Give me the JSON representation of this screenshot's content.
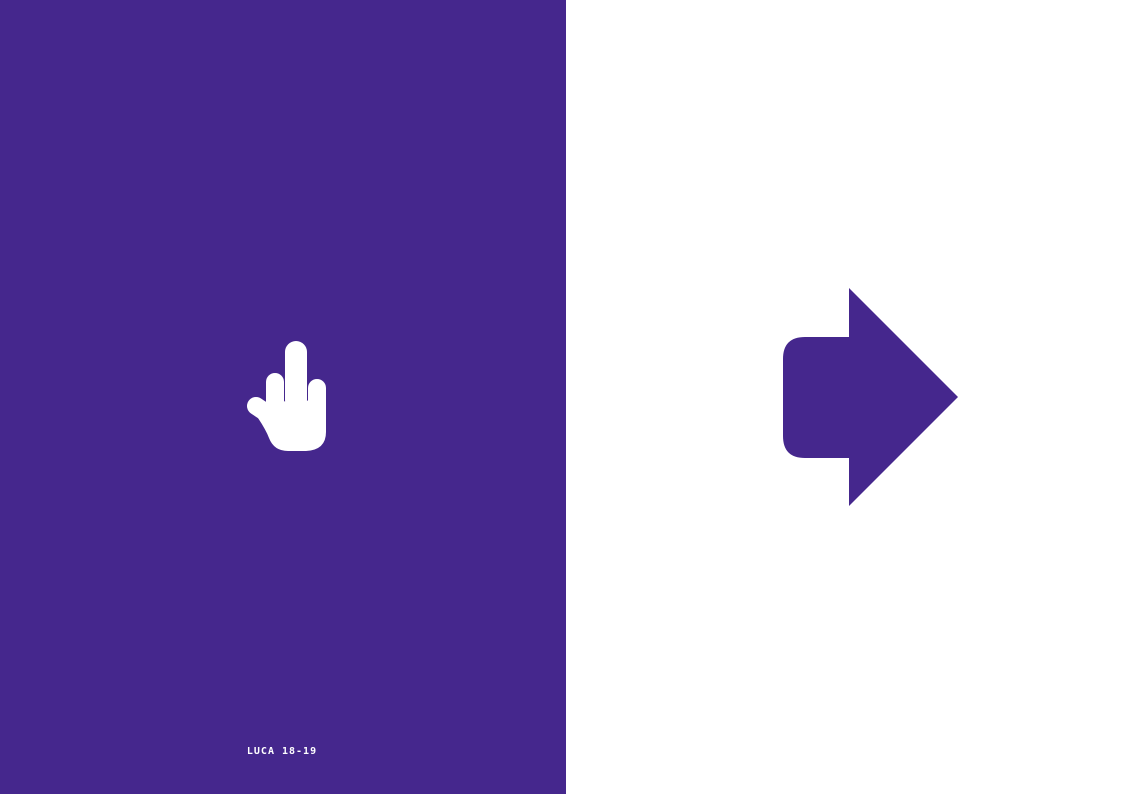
{
  "colors": {
    "left_background": "#45278D",
    "right_background": "#FFFFFF",
    "hand": "#FFFFFF",
    "arrow": "#45278D",
    "caption": "#FFFFFF"
  },
  "left_page": {
    "icon": "middle-finger-hand-icon",
    "caption": "LUCA 18-19"
  },
  "right_page": {
    "icon": "right-arrow-icon"
  }
}
